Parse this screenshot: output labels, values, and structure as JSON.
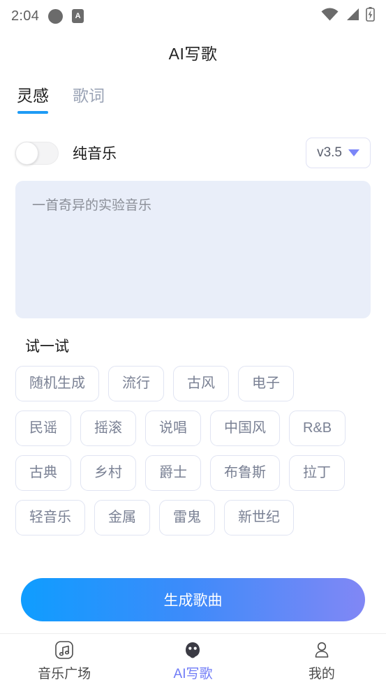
{
  "status_bar": {
    "time": "2:04",
    "badge_letter": "A",
    "icons": [
      "circle-icon",
      "a-badge-icon",
      "wifi-icon",
      "cellular-signal-icon",
      "battery-charging-icon"
    ]
  },
  "header": {
    "title": "AI写歌"
  },
  "tabs": [
    {
      "label": "灵感",
      "active": true
    },
    {
      "label": "歌词",
      "active": false
    }
  ],
  "options": {
    "pure_music_label": "纯音乐",
    "pure_music_on": false,
    "version": "v3.5"
  },
  "prompt": {
    "value": "",
    "placeholder": "一首奇异的实验音乐"
  },
  "try_section": {
    "title": "试一试",
    "rows": [
      [
        "随机生成",
        "流行",
        "古风",
        "电子"
      ],
      [
        "民谣",
        "摇滚",
        "说唱",
        "中国风",
        "R&B"
      ],
      [
        "古典",
        "乡村",
        "爵士",
        "布鲁斯",
        "拉丁"
      ],
      [
        "轻音乐",
        "金属",
        "雷鬼",
        "新世纪"
      ]
    ]
  },
  "generate": {
    "label": "生成歌曲"
  },
  "bottom_nav": [
    {
      "label": "音乐广场",
      "icon": "music-square-icon",
      "active": false
    },
    {
      "label": "AI写歌",
      "icon": "ai-robot-icon",
      "active": true
    },
    {
      "label": "我的",
      "icon": "person-icon",
      "active": false
    }
  ],
  "colors": {
    "tab_underline": "#1e9bf5",
    "accent_purple": "#6f7bf7",
    "prompt_bg": "#e9eef9",
    "chip_border": "#e0e4f2",
    "cta_gradient_start": "#0f9dff",
    "cta_gradient_end": "#8187f5"
  }
}
